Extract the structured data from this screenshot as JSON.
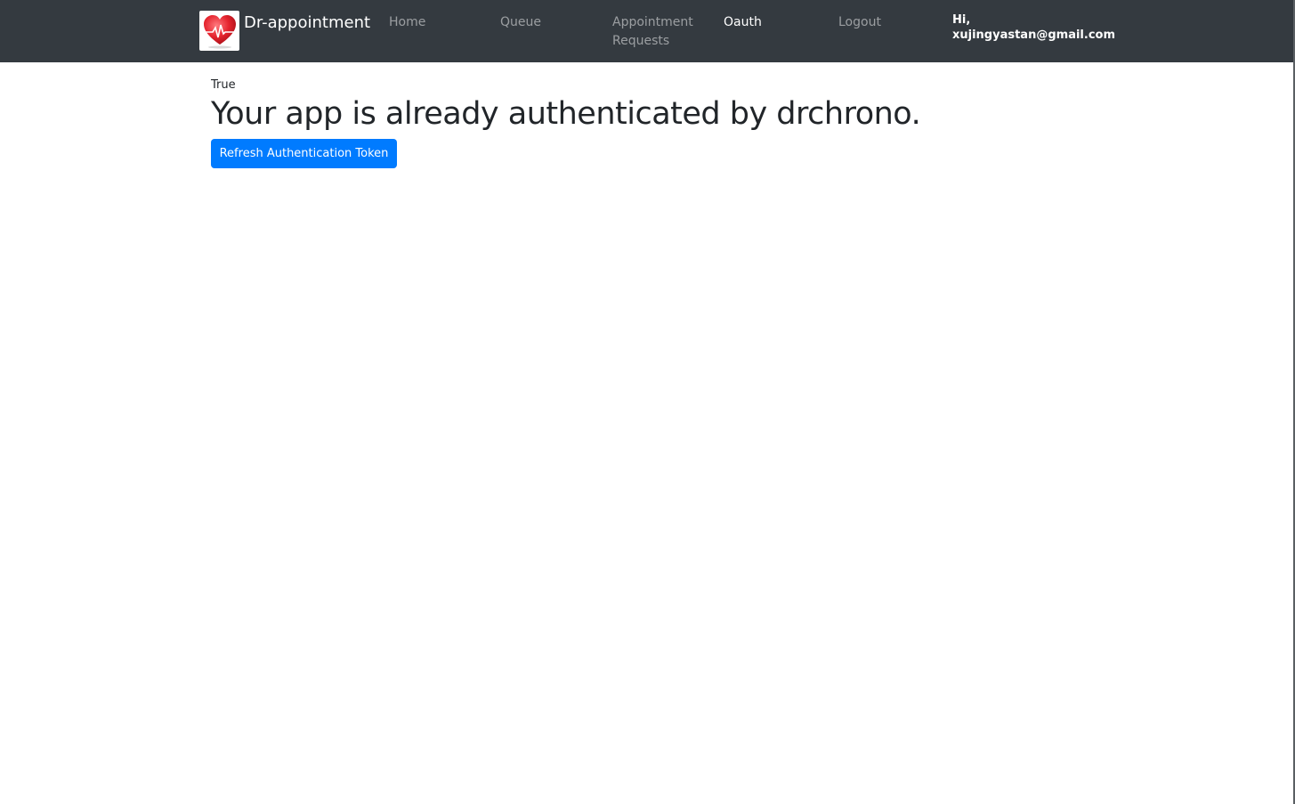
{
  "navbar": {
    "brand": {
      "logo_icon": "heart-ecg-icon",
      "name": "Dr-appointment"
    },
    "links": [
      {
        "label": "Home",
        "active": false
      },
      {
        "label": "Queue",
        "active": false
      },
      {
        "label": "Appointment Requests",
        "active": false
      },
      {
        "label": "Oauth",
        "active": true
      },
      {
        "label": "Logout",
        "active": false
      }
    ],
    "greeting": "Hi, xujingyastan@gmail.com"
  },
  "main": {
    "status": "True",
    "title": "Your app is already authenticated by drchrono.",
    "refresh_button_label": "Refresh Authentication Token"
  },
  "colors": {
    "navbar_bg": "#343a40",
    "primary": "#007bff",
    "logo_heart": "#e5242e"
  }
}
